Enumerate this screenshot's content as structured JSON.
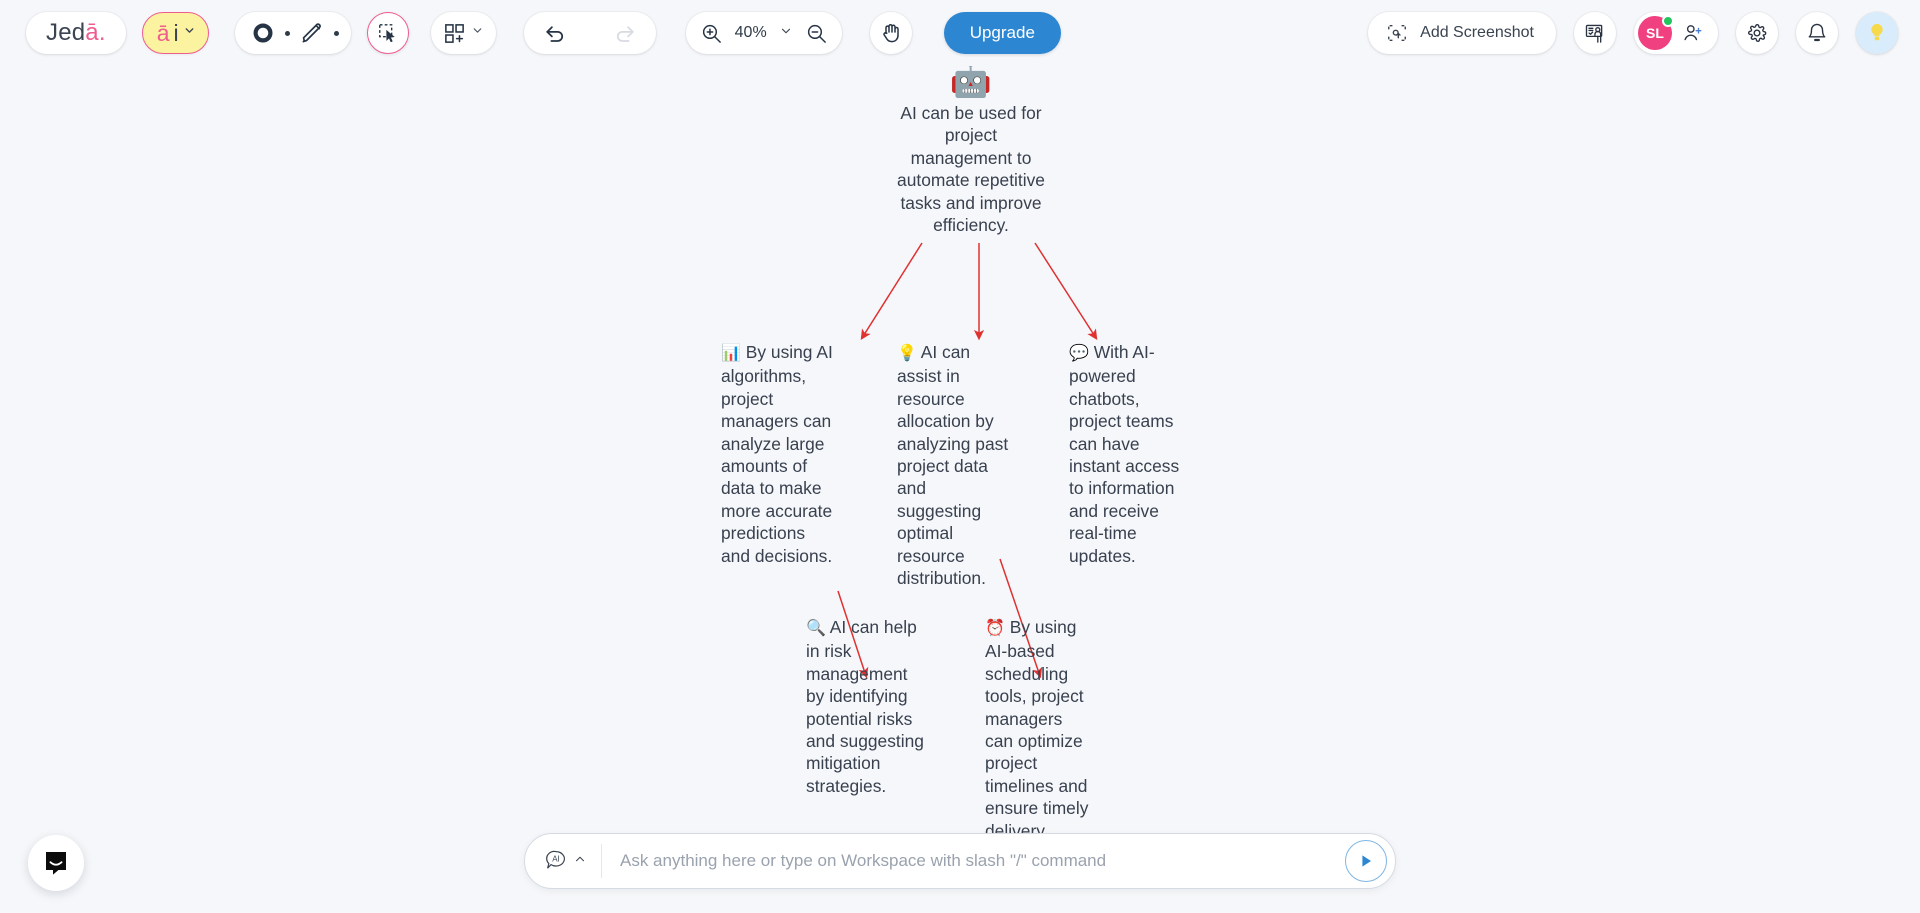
{
  "app": {
    "logo_jed": "Jed",
    "logo_a": "ā",
    "logo_dot": ".",
    "background": "#f5f7fa"
  },
  "toolbar": {
    "ai_pill": {
      "a": "ā",
      "i": "i",
      "icon": "chevron-down-icon"
    },
    "shape_tool": "shape-circle-icon",
    "pen_tool": "pen-icon",
    "select_tool": "marquee-select-icon",
    "layout_tool": "add-frame-icon",
    "undo": "undo-icon",
    "redo": "redo-icon",
    "zoom_in": "zoom-in-icon",
    "zoom_out": "zoom-out-icon",
    "zoom_level": "40%",
    "pan_tool": "hand-icon",
    "upgrade_label": "Upgrade",
    "add_screenshot_label": "Add Screenshot",
    "add_screenshot_icon": "screenshot-icon",
    "present_icon": "presentation-icon",
    "avatar_initials": "SL",
    "invite_icon": "add-person-icon",
    "settings_icon": "gear-icon",
    "notifications_icon": "bell-icon",
    "tips_icon": "lightbulb-icon",
    "accent_pink": "#ef5d8f",
    "accent_blue": "#2d86d1",
    "avatar_color": "#f0407f",
    "presence_color": "#22c55e"
  },
  "canvas": {
    "arrow_color": "#e03131",
    "nodes": {
      "root": {
        "emoji": "🤖",
        "emoji_name": "robot-emoji",
        "text": "AI can be used for project management to automate repetitive tasks and improve efficiency."
      },
      "a": {
        "emoji": "📊",
        "emoji_name": "bar-chart-emoji",
        "text": "By using AI algorithms, project managers can analyze large amounts of data to make more accurate predictions and decisions."
      },
      "b": {
        "emoji": "💡",
        "emoji_name": "lightbulb-emoji",
        "text": "AI can assist in resource allocation by analyzing past project data and suggesting optimal resource distribution."
      },
      "c": {
        "emoji": "💬",
        "emoji_name": "speech-balloon-emoji",
        "text": "With AI-powered chatbots, project teams can have instant access to information and receive real-time updates."
      },
      "d": {
        "emoji": "🔍",
        "emoji_name": "magnifying-glass-emoji",
        "text": "AI can help in risk management by identifying potential risks and suggesting mitigation strategies."
      },
      "e": {
        "emoji": "⏰",
        "emoji_name": "alarm-clock-emoji",
        "text": "By using AI-based scheduling tools, project managers can optimize project timelines and ensure timely delivery."
      }
    }
  },
  "prompt": {
    "ai_chip_label": "AI",
    "ai_chip_icon": "ai-bubble-icon",
    "chevron_icon": "chevron-up-icon",
    "placeholder": "Ask anything here or type on Workspace with slash \"/\" command",
    "value": "",
    "send_icon": "send-play-icon"
  },
  "chat_launcher": {
    "icon": "intercom-chat-icon"
  }
}
